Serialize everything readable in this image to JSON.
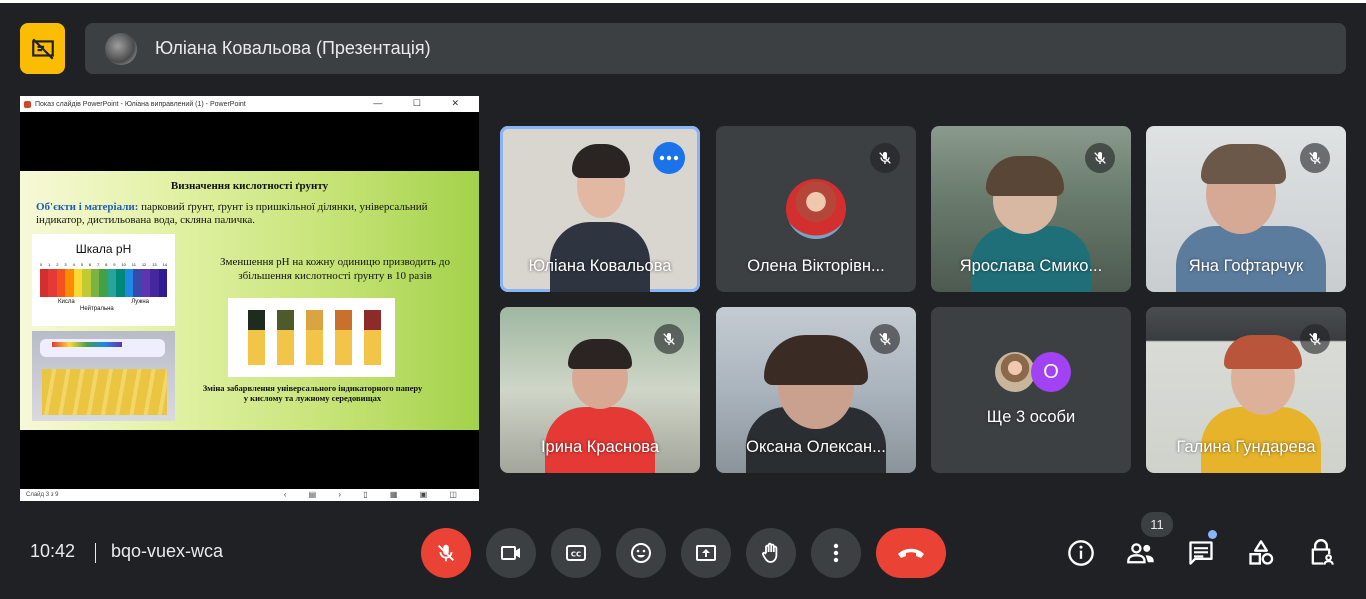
{
  "presentation": {
    "presenter_label": "Юліана Ковальова (Презентація)",
    "window_title": "Показ слайдів PowerPoint - Юліана виправлений (1) - PowerPoint",
    "window_controls": "— ☐ ✕",
    "status_left": "Слайд 3 з 9",
    "status_nav": "‹ ▤ › ▯ ▦ ▣ ◫"
  },
  "slide": {
    "title": "Визначення кислотності ґрунту",
    "materials_label": "Об'єкти і матеріали:",
    "materials_text": " парковий ґрунт, ґрунт із пришкільної ділянки, універсальний індикатор, дистильована вода, скляна паличка.",
    "ph_scale_title": "Шкала pH",
    "ph_numbers": [
      "0",
      "1",
      "2",
      "3",
      "4",
      "5",
      "6",
      "7",
      "8",
      "9",
      "10",
      "11",
      "12",
      "13",
      "14"
    ],
    "ph_colors": [
      "#d32f2f",
      "#e53935",
      "#f4511e",
      "#fb8c00",
      "#fdd835",
      "#c0ca33",
      "#7cb342",
      "#43a047",
      "#26a69a",
      "#00897b",
      "#1e88e5",
      "#3949ab",
      "#5e35b1",
      "#4527a0",
      "#311b92"
    ],
    "ph_acid": "Кисла",
    "ph_alkaline": "Лужна",
    "ph_neutral": "Нейтральна",
    "ph_text": "Зменшення pH на кожну одиницю призводить до збільшення кислотності ґрунту в 10 разів",
    "strip_colors": [
      "#1f2b1e",
      "#4f5a2b",
      "#d9a441",
      "#c8702c",
      "#8d2a2a"
    ],
    "caption": "Зміна забарвлення універсального індикаторного паперу у кислому та лужному середовищах"
  },
  "participants": [
    {
      "name": "Юліана Ковальова",
      "active": true,
      "muted": false
    },
    {
      "name": "Олена Вікторівн...",
      "muted": true
    },
    {
      "name": "Ярослава Смико...",
      "muted": true
    },
    {
      "name": "Яна Гофтарчук",
      "muted": true
    },
    {
      "name": "Ірина Краснова",
      "muted": true
    },
    {
      "name": "Оксана Олексан...",
      "muted": true
    },
    {
      "name": "Ще 3 особи",
      "avatar_letter": "О"
    },
    {
      "name": "Галина Гундарева",
      "muted": true
    }
  ],
  "meeting": {
    "time": "10:42",
    "code": "bqo-vuex-wca",
    "participant_count": "11"
  },
  "colors": {
    "background": "#202124",
    "panel": "#3c4043",
    "accent": "#8ab4f8",
    "danger": "#ea4335",
    "present_yellow": "#fbbc04"
  }
}
